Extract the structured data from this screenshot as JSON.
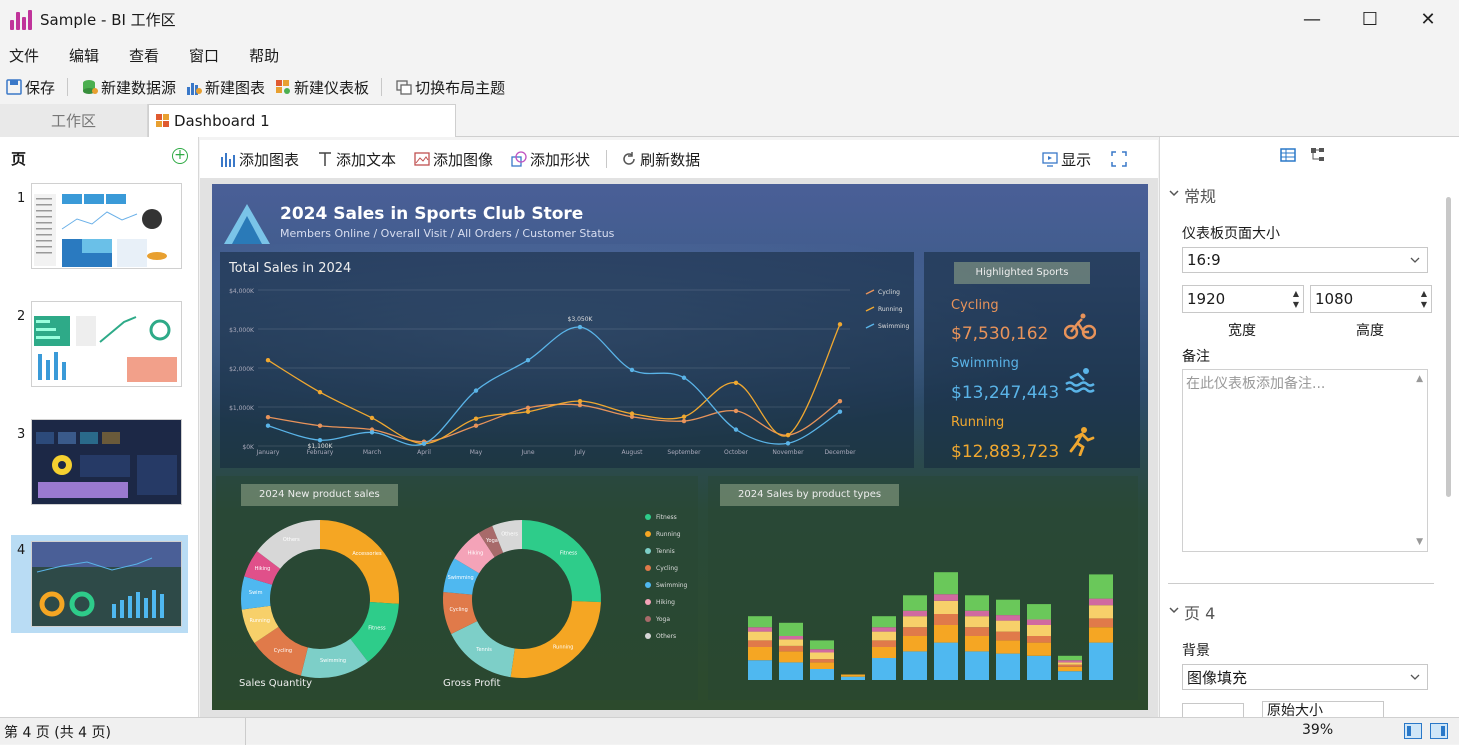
{
  "window": {
    "title": "Sample - BI 工作区",
    "min": "—",
    "max": "☐",
    "close": "✕"
  },
  "menu": [
    "文件",
    "编辑",
    "查看",
    "窗口",
    "帮助"
  ],
  "toolbar": {
    "save": "保存",
    "new_datasource": "新建数据源",
    "new_chart": "新建图表",
    "new_dashboard": "新建仪表板",
    "switch_theme": "切换布局主题"
  },
  "tabs": {
    "workspace": "工作区",
    "dashboard": "Dashboard 1"
  },
  "pages": {
    "title": "页",
    "items": [
      "1",
      "2",
      "3",
      "4"
    ]
  },
  "canvas_toolbar": {
    "add_chart": "添加图表",
    "add_text": "添加文本",
    "add_image": "添加图像",
    "add_shape": "添加形状",
    "refresh": "刷新数据",
    "display": "显示"
  },
  "dashboard": {
    "title": "2024 Sales in Sports Club Store",
    "subtitle": "Members Online / Overall Visit / All Orders / Customer Status",
    "line_title": "Total Sales in 2024",
    "highlight_title": "Highlighted Sports",
    "highlights": [
      {
        "name": "Cycling",
        "value": "$7,530,162",
        "color": "#e8935a"
      },
      {
        "name": "Swimming",
        "value": "$13,247,443",
        "color": "#5ab4e8"
      },
      {
        "name": "Running",
        "value": "$12,883,723",
        "color": "#f0a830"
      }
    ],
    "donut_panel_title": "2024 New product sales",
    "donut1_label": "Sales Quantity",
    "donut2_label": "Gross Profit",
    "bar_panel_title": "2024 Sales by product types"
  },
  "chart_data": [
    {
      "type": "line",
      "title": "Total Sales in 2024",
      "categories": [
        "January",
        "February",
        "March",
        "April",
        "May",
        "June",
        "July",
        "August",
        "September",
        "October",
        "November",
        "December"
      ],
      "yticks": [
        "$0K",
        "$1,000K",
        "$2,000K",
        "$3,000K",
        "$4,000K"
      ],
      "ylim": [
        0,
        4000
      ],
      "series": [
        {
          "name": "Cycling",
          "color": "#e8935a",
          "values": [
            740,
            520,
            420,
            110,
            520,
            980,
            1050,
            750,
            640,
            900,
            280,
            1150
          ]
        },
        {
          "name": "Running",
          "color": "#f0a830",
          "values": [
            2200,
            1380,
            720,
            60,
            700,
            880,
            1150,
            830,
            750,
            1620,
            280,
            3120
          ]
        },
        {
          "name": "Swimming",
          "color": "#5ab4e8",
          "values": [
            520,
            150,
            350,
            60,
            1420,
            2200,
            3050,
            1950,
            1750,
            420,
            70,
            880
          ]
        }
      ],
      "annotations": [
        "$3,050K",
        "$1,100K"
      ]
    },
    {
      "type": "pie",
      "title": "Sales Quantity",
      "slices": [
        {
          "label": "Accessories",
          "value": 2000,
          "color": "#f5a623"
        },
        {
          "label": "Fitness",
          "value": 1050,
          "color": "#2ecc8a"
        },
        {
          "label": "Swimming",
          "value": 1100,
          "color": "#7dcfc8"
        },
        {
          "label": "Cycling",
          "value": 900,
          "color": "#e07a4a"
        },
        {
          "label": "Running",
          "value": 560,
          "color": "#f7d06a"
        },
        {
          "label": "Swim",
          "value": 520,
          "color": "#4fb8f0"
        },
        {
          "label": "Hiking",
          "value": 440,
          "color": "#e0508a"
        },
        {
          "label": "Others",
          "value": 1130,
          "color": "#d7d7d7"
        }
      ]
    },
    {
      "type": "pie",
      "title": "Gross Profit",
      "slices": [
        {
          "label": "Fitness",
          "value": 2500,
          "color": "#2ecc8a"
        },
        {
          "label": "Running",
          "value": 2600,
          "color": "#f5a623"
        },
        {
          "label": "Tennis",
          "value": 1500,
          "color": "#7dcfc8"
        },
        {
          "label": "Cycling",
          "value": 850,
          "color": "#e07a4a"
        },
        {
          "label": "Swimming",
          "value": 700,
          "color": "#4fb8f0"
        },
        {
          "label": "Hiking",
          "value": 700,
          "color": "#f4a3b8"
        },
        {
          "label": "Yoga",
          "value": 300,
          "color": "#a86a6a"
        },
        {
          "label": "Others",
          "value": 600,
          "color": "#d7d7d7"
        }
      ],
      "legend": [
        "Fitness",
        "Running",
        "Tennis",
        "Cycling",
        "Swimming",
        "Hiking",
        "Yoga",
        "Others"
      ]
    },
    {
      "type": "bar",
      "title": "2024 Sales by product types",
      "stack_colors": [
        "#4fb8f0",
        "#f5a623",
        "#e07a4a",
        "#f7d06a",
        "#d06aa0",
        "#6ac85a"
      ],
      "bars": [
        [
          18,
          12,
          6,
          8,
          4,
          10
        ],
        [
          16,
          10,
          5,
          6,
          3,
          12
        ],
        [
          10,
          6,
          3,
          6,
          3,
          8
        ],
        [
          3,
          2,
          0,
          0,
          0,
          0
        ],
        [
          20,
          10,
          6,
          8,
          4,
          10
        ],
        [
          26,
          14,
          8,
          10,
          5,
          14
        ],
        [
          34,
          16,
          10,
          12,
          6,
          20
        ],
        [
          26,
          14,
          8,
          10,
          5,
          14
        ],
        [
          24,
          12,
          8,
          10,
          5,
          14
        ],
        [
          22,
          12,
          6,
          10,
          5,
          14
        ],
        [
          8,
          4,
          2,
          2,
          2,
          4
        ],
        [
          34,
          14,
          8,
          12,
          6,
          22
        ]
      ]
    }
  ],
  "props": {
    "general": "常规",
    "page_size_label": "仪表板页面大小",
    "page_size": "16:9",
    "width": "1920",
    "height": "1080",
    "width_label": "宽度",
    "height_label": "高度",
    "notes_label": "备注",
    "notes_placeholder": "在此仪表板添加备注...",
    "page_section": "页 4",
    "bg_label": "背景",
    "bg_value": "图像填充",
    "size_value": "原始大小"
  },
  "status": {
    "page": "第 4 页  (共 4 页)",
    "zoom": "39%"
  }
}
